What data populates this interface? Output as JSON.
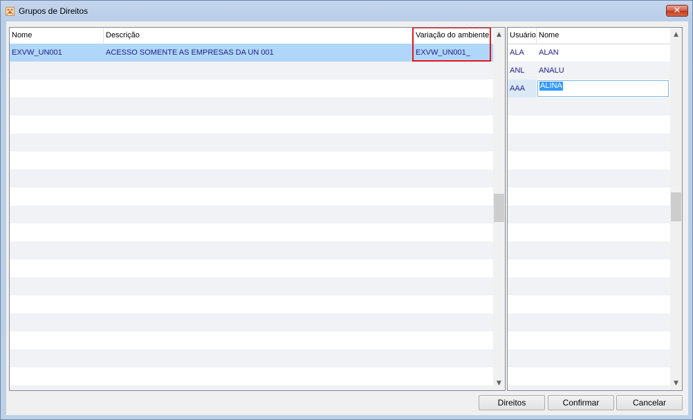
{
  "window": {
    "title": "Grupos de Direitos",
    "close_glyph": "✕"
  },
  "groups_grid": {
    "columns": [
      "Nome",
      "Descrição",
      "Variação do ambiente"
    ],
    "rows": [
      {
        "nome": "EXVW_UN001",
        "descricao": "ACESSO SOMENTE AS EMPRESAS DA UN 001",
        "variacao": "EXVW_UN001_"
      }
    ],
    "highlighted_column": "Variação do ambiente",
    "highlight_color": "#e0141e",
    "selected_row_color": "#b0d7f9"
  },
  "users_grid": {
    "columns": [
      "Usuário",
      "Nome"
    ],
    "rows": [
      {
        "usuario": "ALA",
        "nome": "ALAN"
      },
      {
        "usuario": "ANL",
        "nome": "ANALU"
      },
      {
        "usuario": "AAA",
        "nome": "ALINA"
      }
    ],
    "editing_row_index": 2
  },
  "buttons": {
    "direitos": "Direitos",
    "confirmar": "Confirmar",
    "cancelar": "Cancelar"
  },
  "icons": {
    "app": "app-logo-icon",
    "scroll_up": "▲",
    "scroll_down": "▼"
  }
}
